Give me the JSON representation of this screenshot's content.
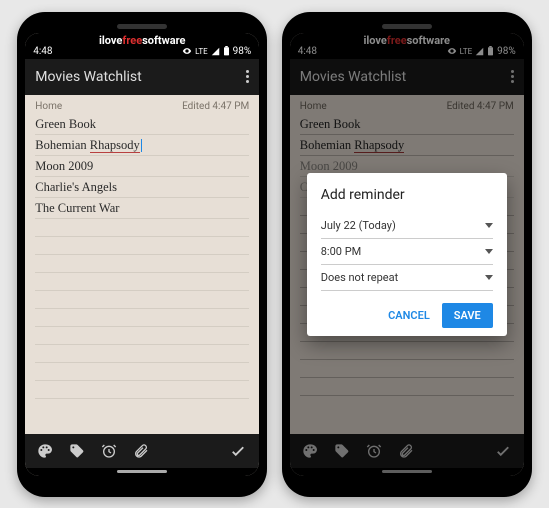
{
  "watermark": {
    "pre": "ilove",
    "mid": "free",
    "post": "software"
  },
  "status": {
    "time": "4:48",
    "net": "LTE",
    "batt": "98%"
  },
  "appbar": {
    "title": "Movies Watchlist"
  },
  "note_meta": {
    "category": "Home",
    "edited": "Edited 4:47 PM"
  },
  "note_lines": [
    "Green Book",
    "Bohemian Rhapsody",
    "Moon 2009",
    "Charlie's Angels",
    "The Current War"
  ],
  "line2": {
    "word1": "Bohemian",
    "word2": "Rhapsody"
  },
  "dialog": {
    "title": "Add reminder",
    "date": "July 22 (Today)",
    "time": "8:00 PM",
    "repeat": "Does not repeat",
    "cancel": "CANCEL",
    "save": "SAVE"
  }
}
